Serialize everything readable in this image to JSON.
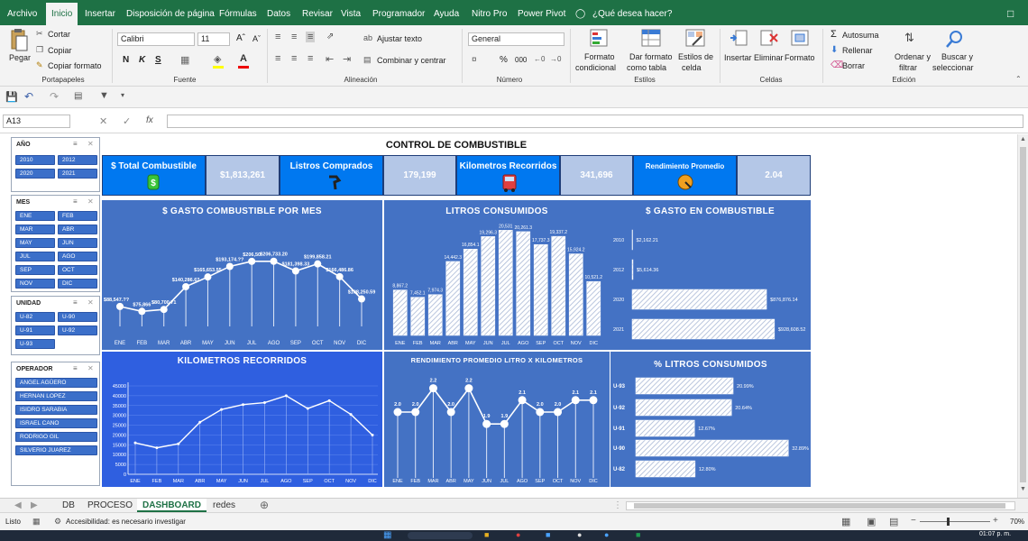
{
  "menu": [
    "Archivo",
    "Inicio",
    "Insertar",
    "Disposición de página",
    "Fórmulas",
    "Datos",
    "Revisar",
    "Vista",
    "Programador",
    "Ayuda",
    "Nitro Pro",
    "Power Pivot"
  ],
  "tell_me": "¿Qué desea hacer?",
  "ribbon": {
    "paste": "Pegar",
    "cut": "Cortar",
    "copy": "Copiar",
    "format_painter": "Copiar formato",
    "clipboard": "Portapapeles",
    "font_name": "Calibri",
    "font_size": "11",
    "bold": "N",
    "italic": "K",
    "underline": "S",
    "font_group": "Fuente",
    "wrap": "Ajustar texto",
    "merge": "Combinar y centrar",
    "alignment_group": "Alineación",
    "number_format": "General",
    "percent": "%",
    "thousands": "000",
    "number_group": "Número",
    "cond_format_1": "Formato",
    "cond_format_2": "condicional",
    "table_format_1": "Dar formato",
    "table_format_2": "como tabla",
    "cell_styles_1": "Estilos de",
    "cell_styles_2": "celda",
    "styles_group": "Estilos",
    "insert": "Insertar",
    "delete": "Eliminar",
    "format": "Formato",
    "cells_group": "Celdas",
    "autosum": "Autosuma",
    "fill": "Rellenar",
    "clear": "Borrar",
    "sort_1": "Ordenar y",
    "sort_2": "filtrar",
    "find_1": "Buscar y",
    "find_2": "seleccionar",
    "editing_group": "Edición"
  },
  "namebox": "A13",
  "fx": "fx",
  "dashboard": {
    "title": "CONTROL DE COMBUSTIBLE",
    "kpis": [
      {
        "label": "$ Total Combustible",
        "value": "$1,813,261"
      },
      {
        "label": "Listros Comprados",
        "value": "179,199"
      },
      {
        "label": "Kilometros Recorridos",
        "value": "341,696"
      },
      {
        "label": "Rendimiento Promedio",
        "value": "2.04"
      }
    ]
  },
  "slicers": {
    "year": {
      "title": "AÑO",
      "items": [
        "2010",
        "2012",
        "2020",
        "2021"
      ]
    },
    "month": {
      "title": "MES",
      "items": [
        "ENE",
        "FEB",
        "MAR",
        "ABR",
        "MAY",
        "JUN",
        "JUL",
        "AGO",
        "SEP",
        "OCT",
        "NOV",
        "DIC"
      ]
    },
    "unit": {
      "title": "UNIDAD",
      "items": [
        "U-82",
        "U-90",
        "U-91",
        "U-92",
        "U-93"
      ]
    },
    "operator": {
      "title": "OPERADOR",
      "items": [
        "ANGEL AGÜERO",
        "HERNAN LOPEZ",
        "ISIDRO SARABIA",
        "ISRAEL CANO",
        "RODRIGO GIL",
        "SILVERIO JUAREZ"
      ]
    }
  },
  "chart_data": [
    {
      "type": "line",
      "title": "$ GASTO COMBUSTIBLE POR MES",
      "categories": [
        "ENE",
        "FEB",
        "MAR",
        "ABR",
        "MAY",
        "JUN",
        "JUL",
        "AGO",
        "SEP",
        "OCT",
        "NOV",
        "DIC"
      ],
      "values": [
        88547,
        75866,
        80700.71,
        140286.67,
        165653.55,
        193174,
        206500,
        206733.2,
        181398.33,
        199858.21,
        166486.86,
        108250.59
      ],
      "data_labels": [
        "$88,547.??",
        "$75,866",
        "$80,700.71",
        "$140,286.67",
        "$165,653.55",
        "$193,174.??",
        "$206,50",
        "$206,733.20",
        "$181,398.33",
        "$199,858.21",
        "$166,486.86",
        "$108,250.59"
      ]
    },
    {
      "type": "bar",
      "title": "LITROS CONSUMIDOS",
      "categories": [
        "ENE",
        "FEB",
        "MAR",
        "ABR",
        "MAY",
        "JUN",
        "JUL",
        "AGO",
        "SEP",
        "OCT",
        "NOV",
        "DIC"
      ],
      "values": [
        8867.2,
        7452.1,
        7974.3,
        14442.3,
        16854.1,
        19296.3,
        20531,
        20261.3,
        17737.3,
        19337.2,
        15924.2,
        10521.2
      ],
      "data_labels": [
        "8,867.2",
        "7,452.1",
        "7,974.3",
        "14,442.3",
        "16,854.1",
        "19,296.3",
        "20,531",
        "20,261.3",
        "17,737.3",
        "19,337.2",
        "15,924.2",
        "10,521.2"
      ]
    },
    {
      "type": "bar",
      "orientation": "horizontal",
      "title": "$ GASTO EN COMBUSTIBLE",
      "categories": [
        "2010",
        "2012",
        "2020",
        "2021"
      ],
      "values": [
        2162.21,
        5614.36,
        876876.14,
        928608.52
      ],
      "data_labels": [
        "$2,162.21",
        "$5,614.36",
        "$876,876.14",
        "$928,608.52"
      ]
    },
    {
      "type": "line",
      "title": "KILOMETROS RECORRIDOS",
      "categories": [
        "ENE",
        "FEB",
        "MAR",
        "ABR",
        "MAY",
        "JUN",
        "JUL",
        "AGO",
        "SEP",
        "OCT",
        "NOV",
        "DIC"
      ],
      "values": [
        16000,
        13500,
        15500,
        26500,
        33000,
        35500,
        36500,
        40000,
        33500,
        37500,
        30500,
        20000
      ],
      "ylim": [
        0,
        45000
      ],
      "yticks": [
        "0",
        "5000",
        "10000",
        "15000",
        "20000",
        "25000",
        "30000",
        "35000",
        "40000",
        "45000"
      ]
    },
    {
      "type": "line",
      "title": "RENDIMIENTO PROMEDIO LITRO X KILOMETROS",
      "categories": [
        "ENE",
        "FEB",
        "MAR",
        "ABR",
        "MAY",
        "JUN",
        "JUL",
        "AGO",
        "SEP",
        "OCT",
        "NOV",
        "DIC"
      ],
      "values": [
        2.0,
        2.0,
        2.2,
        2.0,
        2.2,
        1.9,
        1.9,
        2.1,
        2.0,
        2.0,
        2.1,
        2.1
      ],
      "data_labels": [
        "2.0",
        "2.0",
        "2.2",
        "2.0",
        "2.2",
        "1.9",
        "1.9",
        "2.1",
        "2.0",
        "2.0",
        "2.1",
        "2.1"
      ]
    },
    {
      "type": "bar",
      "orientation": "horizontal",
      "title": "% LITROS CONSUMIDOS",
      "categories": [
        "U-93",
        "U-92",
        "U-91",
        "U-90",
        "U-82"
      ],
      "values": [
        20.99,
        20.64,
        12.67,
        32.89,
        12.8
      ],
      "data_labels": [
        "20.99%",
        "20.64%",
        "12.67%",
        "32.89%",
        "12.80%"
      ]
    }
  ],
  "sheet_tabs": [
    "DB",
    "PROCESO",
    "DASHBOARD",
    "redes"
  ],
  "status": {
    "ready": "Listo",
    "accessibility": "Accesibilidad: es necesario investigar",
    "zoom": "70%"
  },
  "taskbar_time": "01:07 p. m.",
  "colors": {
    "excel_green": "#1e7145",
    "kpi_blue": "#0078f0",
    "panel_blue": "#4472c4",
    "kpi_value_bg": "#b4c7e7"
  }
}
